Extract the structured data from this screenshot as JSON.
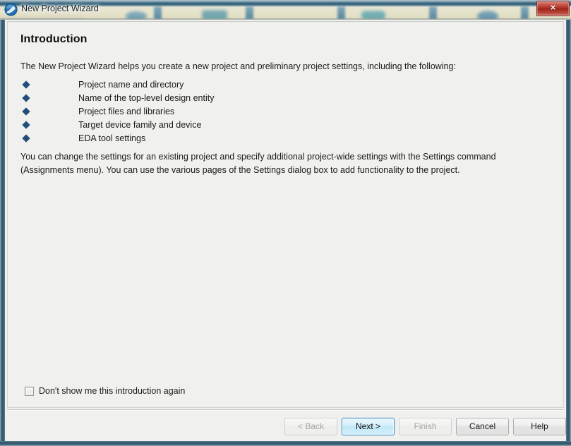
{
  "window": {
    "title": "New Project Wizard",
    "app_icon": "quartus-globe-icon",
    "close_label": "×",
    "frame_color": "#2f5a72",
    "content_bg": "#f0f0ee"
  },
  "page": {
    "heading": "Introduction",
    "intro_paragraph": "The New Project Wizard helps you create a new project and preliminary project settings, including the following:",
    "bullets": [
      {
        "label": "Project name and directory"
      },
      {
        "label": "Name of the top-level design entity"
      },
      {
        "label": "Project files and libraries"
      },
      {
        "label": "Target device family and device"
      },
      {
        "label": "EDA tool settings"
      }
    ],
    "bullet_color": "#1f4e79",
    "closing_paragraph": "You can change the settings for an existing project and specify additional project-wide settings with the Settings command (Assignments menu). You can use the various pages of the Settings dialog box to add functionality to the project."
  },
  "options": {
    "dont_show_again_label": "Don't show me this introduction again",
    "dont_show_again_checked": false
  },
  "buttons": {
    "back": {
      "label": "< Back",
      "enabled": false
    },
    "next": {
      "label": "Next >",
      "enabled": true,
      "is_default": true,
      "accent": "#3c8fc4"
    },
    "finish": {
      "label": "Finish",
      "enabled": false
    },
    "cancel": {
      "label": "Cancel",
      "enabled": true
    },
    "help": {
      "label": "Help",
      "enabled": true
    }
  }
}
